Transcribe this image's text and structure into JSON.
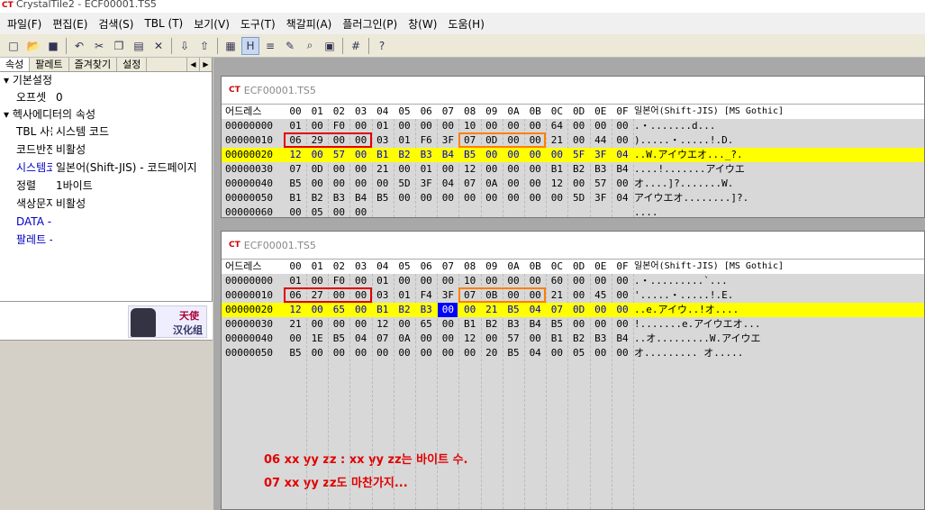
{
  "titlebar": {
    "title": "CrystalTile2 - ECF00001.TS5"
  },
  "menu": [
    "파일(F)",
    "편집(E)",
    "검색(S)",
    "TBL (T)",
    "보기(V)",
    "도구(T)",
    "책갈피(A)",
    "플러그인(P)",
    "창(W)",
    "도움(H)"
  ],
  "toolbar": {
    "icons": [
      "new-icon",
      "open-icon",
      "save-icon",
      "undo-icon",
      "cut-icon",
      "copy-icon",
      "paste-icon",
      "delete-icon",
      "import-icon",
      "export-icon",
      "tile-view-icon",
      "hex-view-icon",
      "text-view-icon",
      "edit-icon",
      "search-icon",
      "print-icon",
      "grid-icon",
      "help-icon"
    ]
  },
  "left_panel": {
    "tabs": [
      "속성",
      "팔레트",
      "즐겨찾기",
      "설정"
    ],
    "cat_basic": "기본설정",
    "cat_hex": "헥사에디터의 속성",
    "props": [
      {
        "name": "오프셋",
        "value": "0"
      },
      {
        "name": "TBL 사용",
        "value": "시스템 코드"
      },
      {
        "name": "코드반전",
        "value": "비활성"
      },
      {
        "name": "시스템코드",
        "value": "일본어(Shift-JIS)  - 코드페이지"
      },
      {
        "name": "정렬",
        "value": "1바이트"
      },
      {
        "name": "색상문자",
        "value": "비활성"
      },
      {
        "name": "DATA -:",
        "value": ""
      },
      {
        "name": "팔레트 -",
        "value": ""
      }
    ],
    "logo_top": "天使",
    "logo_bottom": "汉化组"
  },
  "header": {
    "addr_label": "어드레스",
    "cols": [
      "00",
      "01",
      "02",
      "03",
      "04",
      "05",
      "06",
      "07",
      "08",
      "09",
      "0A",
      "0B",
      "0C",
      "0D",
      "0E",
      "0F"
    ],
    "text_label": "일본어(Shift-JIS) [MS Gothic]"
  },
  "window1": {
    "title": "ECF00001.TS5",
    "rows": [
      {
        "addr": "00000000",
        "bytes": [
          "01",
          "00",
          "F0",
          "00",
          "01",
          "00",
          "00",
          "00",
          "10",
          "00",
          "00",
          "00",
          "64",
          "00",
          "00",
          "00"
        ],
        "text": ".・.......d..."
      },
      {
        "addr": "00000010",
        "bytes": [
          "06",
          "29",
          "00",
          "00",
          "03",
          "01",
          "F6",
          "3F",
          "07",
          "0D",
          "00",
          "00",
          "21",
          "00",
          "44",
          "00"
        ],
        "text": ").....・.....!.D."
      },
      {
        "addr": "00000020",
        "bytes": [
          "12",
          "00",
          "57",
          "00",
          "B1",
          "B2",
          "B3",
          "B4",
          "B5",
          "00",
          "00",
          "00",
          "00",
          "5F",
          "3F",
          "04"
        ],
        "text": "..W.アイウエオ..._?."
      },
      {
        "addr": "00000030",
        "bytes": [
          "07",
          "0D",
          "00",
          "00",
          "21",
          "00",
          "01",
          "00",
          "12",
          "00",
          "00",
          "00",
          "B1",
          "B2",
          "B3",
          "B4"
        ],
        "text": "....!.......アイウエ"
      },
      {
        "addr": "00000040",
        "bytes": [
          "B5",
          "00",
          "00",
          "00",
          "00",
          "5D",
          "3F",
          "04",
          "07",
          "0A",
          "00",
          "00",
          "12",
          "00",
          "57",
          "00"
        ],
        "text": "オ....]?.......W."
      },
      {
        "addr": "00000050",
        "bytes": [
          "B1",
          "B2",
          "B3",
          "B4",
          "B5",
          "00",
          "00",
          "00",
          "00",
          "00",
          "00",
          "00",
          "00",
          "5D",
          "3F",
          "04"
        ],
        "text": "アイウエオ........]?."
      },
      {
        "addr": "00000060",
        "bytes": [
          "00",
          "05",
          "00",
          "00",
          "",
          "",
          "",
          "",
          "",
          "",
          "",
          "",
          "",
          "",
          "",
          ""
        ],
        "text": "...."
      }
    ]
  },
  "window2": {
    "title": "ECF00001.TS5",
    "rows": [
      {
        "addr": "00000000",
        "bytes": [
          "01",
          "00",
          "F0",
          "00",
          "01",
          "00",
          "00",
          "00",
          "10",
          "00",
          "00",
          "00",
          "60",
          "00",
          "00",
          "00"
        ],
        "text": ".・.........`..."
      },
      {
        "addr": "00000010",
        "bytes": [
          "06",
          "27",
          "00",
          "00",
          "03",
          "01",
          "F4",
          "3F",
          "07",
          "0B",
          "00",
          "00",
          "21",
          "00",
          "45",
          "00"
        ],
        "text": "'.....・.....!.E."
      },
      {
        "addr": "00000020",
        "bytes": [
          "12",
          "00",
          "65",
          "00",
          "B1",
          "B2",
          "B3",
          "00",
          "00",
          "21",
          "B5",
          "04",
          "07",
          "0D",
          "00",
          "00"
        ],
        "text": "..e.アイウ..!オ...."
      },
      {
        "addr": "00000030",
        "bytes": [
          "21",
          "00",
          "00",
          "00",
          "12",
          "00",
          "65",
          "00",
          "B1",
          "B2",
          "B3",
          "B4",
          "B5",
          "00",
          "00",
          "00"
        ],
        "text": "!.......e.アイウエオ..."
      },
      {
        "addr": "00000040",
        "bytes": [
          "00",
          "1E",
          "B5",
          "04",
          "07",
          "0A",
          "00",
          "00",
          "12",
          "00",
          "57",
          "00",
          "B1",
          "B2",
          "B3",
          "B4"
        ],
        "text": "..オ.........W.アイウエ"
      },
      {
        "addr": "00000050",
        "bytes": [
          "B5",
          "00",
          "00",
          "00",
          "00",
          "00",
          "00",
          "00",
          "00",
          "20",
          "B5",
          "04",
          "00",
          "05",
          "00",
          "00"
        ],
        "text": "オ......... オ....."
      }
    ]
  },
  "notes": [
    "06 xx yy zz : xx yy zz는 바이트 수.",
    "07 xx yy zz도 마찬가지..."
  ]
}
